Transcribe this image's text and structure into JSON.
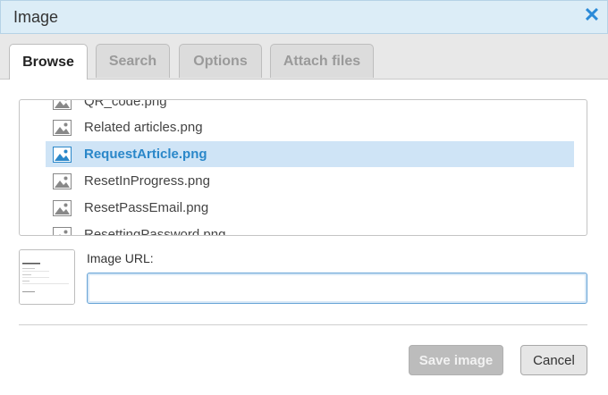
{
  "dialog": {
    "title": "Image",
    "close_icon": "close-icon"
  },
  "tabs": [
    {
      "label": "Browse",
      "active": true
    },
    {
      "label": "Search",
      "active": false
    },
    {
      "label": "Options",
      "active": false
    },
    {
      "label": "Attach files",
      "active": false
    }
  ],
  "files": [
    {
      "name": "QR_code.png",
      "icon": "image-file-icon",
      "selected": false
    },
    {
      "name": "Related articles.png",
      "icon": "image-file-icon",
      "selected": false
    },
    {
      "name": "RequestArticle.png",
      "icon": "image-file-icon",
      "selected": true
    },
    {
      "name": "ResetInProgress.png",
      "icon": "image-file-icon",
      "selected": false
    },
    {
      "name": "ResetPassEmail.png",
      "icon": "image-file-icon",
      "selected": false
    },
    {
      "name": "ResettingPassword.png",
      "icon": "image-file-icon",
      "selected": false
    }
  ],
  "preview": {
    "thumbnail_title": "Request Article"
  },
  "url_field": {
    "label": "Image URL:",
    "value": "",
    "placeholder": ""
  },
  "buttons": {
    "save_label": "Save image",
    "cancel_label": "Cancel"
  },
  "colors": {
    "accent": "#2a87c9",
    "selected_row": "#cfe4f6",
    "titlebar": "#dcedf7"
  }
}
